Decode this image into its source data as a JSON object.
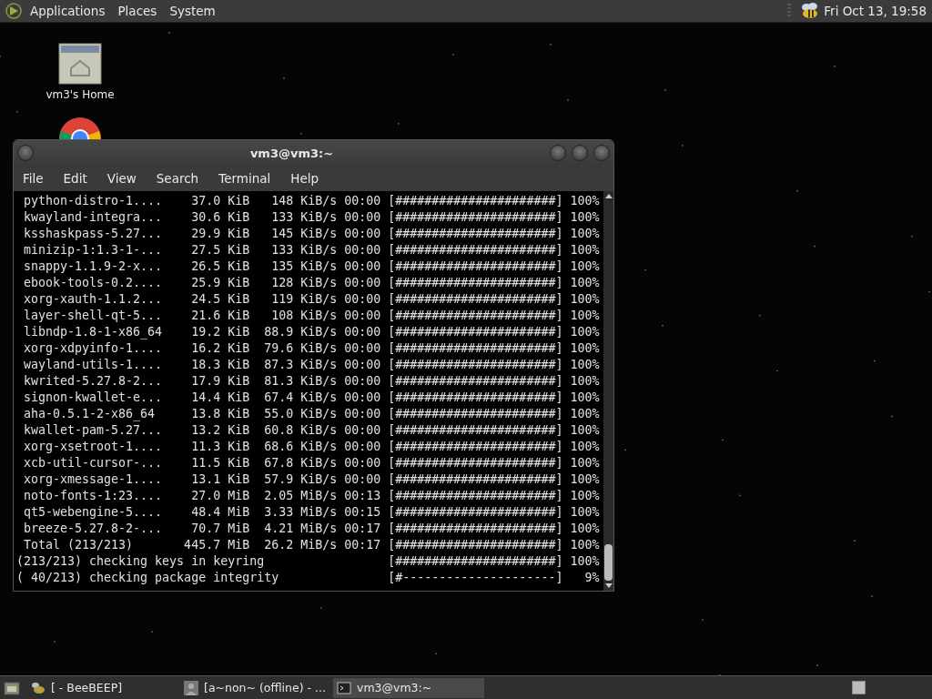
{
  "top_panel": {
    "menus": [
      "Applications",
      "Places",
      "System"
    ],
    "clock": "Fri Oct 13, 19:58"
  },
  "desktop_icons": [
    {
      "kind": "home",
      "label": "vm3's Home"
    },
    {
      "kind": "chrome"
    }
  ],
  "terminal": {
    "title": "vm3@vm3:~",
    "menu": [
      "File",
      "Edit",
      "View",
      "Search",
      "Terminal",
      "Help"
    ],
    "lines": [
      " python-distro-1....    37.0 KiB   148 KiB/s 00:00 [######################] 100%",
      " kwayland-integra...    30.6 KiB   133 KiB/s 00:00 [######################] 100%",
      " ksshaskpass-5.27...    29.9 KiB   145 KiB/s 00:00 [######################] 100%",
      " minizip-1:1.3-1-...    27.5 KiB   133 KiB/s 00:00 [######################] 100%",
      " snappy-1.1.9-2-x...    26.5 KiB   135 KiB/s 00:00 [######################] 100%",
      " ebook-tools-0.2....    25.9 KiB   128 KiB/s 00:00 [######################] 100%",
      " xorg-xauth-1.1.2...    24.5 KiB   119 KiB/s 00:00 [######################] 100%",
      " layer-shell-qt-5...    21.6 KiB   108 KiB/s 00:00 [######################] 100%",
      " libndp-1.8-1-x86_64    19.2 KiB  88.9 KiB/s 00:00 [######################] 100%",
      " xorg-xdpyinfo-1....    16.2 KiB  79.6 KiB/s 00:00 [######################] 100%",
      " wayland-utils-1....    18.3 KiB  87.3 KiB/s 00:00 [######################] 100%",
      " kwrited-5.27.8-2...    17.9 KiB  81.3 KiB/s 00:00 [######################] 100%",
      " signon-kwallet-e...    14.4 KiB  67.4 KiB/s 00:00 [######################] 100%",
      " aha-0.5.1-2-x86_64     13.8 KiB  55.0 KiB/s 00:00 [######################] 100%",
      " kwallet-pam-5.27...    13.2 KiB  60.8 KiB/s 00:00 [######################] 100%",
      " xorg-xsetroot-1....    11.3 KiB  68.6 KiB/s 00:00 [######################] 100%",
      " xcb-util-cursor-...    11.5 KiB  67.8 KiB/s 00:00 [######################] 100%",
      " xorg-xmessage-1....    13.1 KiB  57.9 KiB/s 00:00 [######################] 100%",
      " noto-fonts-1:23....    27.0 MiB  2.05 MiB/s 00:13 [######################] 100%",
      " qt5-webengine-5....    48.4 MiB  3.33 MiB/s 00:15 [######################] 100%",
      " breeze-5.27.8-2-...    70.7 MiB  4.21 MiB/s 00:17 [######################] 100%",
      " Total (213/213)       445.7 MiB  26.2 MiB/s 00:17 [######################] 100%",
      "(213/213) checking keys in keyring                 [######################] 100%",
      "( 40/213) checking package integrity               [#---------------------]   9%"
    ]
  },
  "taskbar": {
    "items": [
      {
        "kind": "bee",
        "label": "[ - BeeBEEP]",
        "selected": false
      },
      {
        "kind": "person",
        "label": "[a~non~ (offline) - ...",
        "selected": false
      },
      {
        "kind": "terminal",
        "label": "vm3@vm3:~",
        "selected": true
      }
    ]
  }
}
